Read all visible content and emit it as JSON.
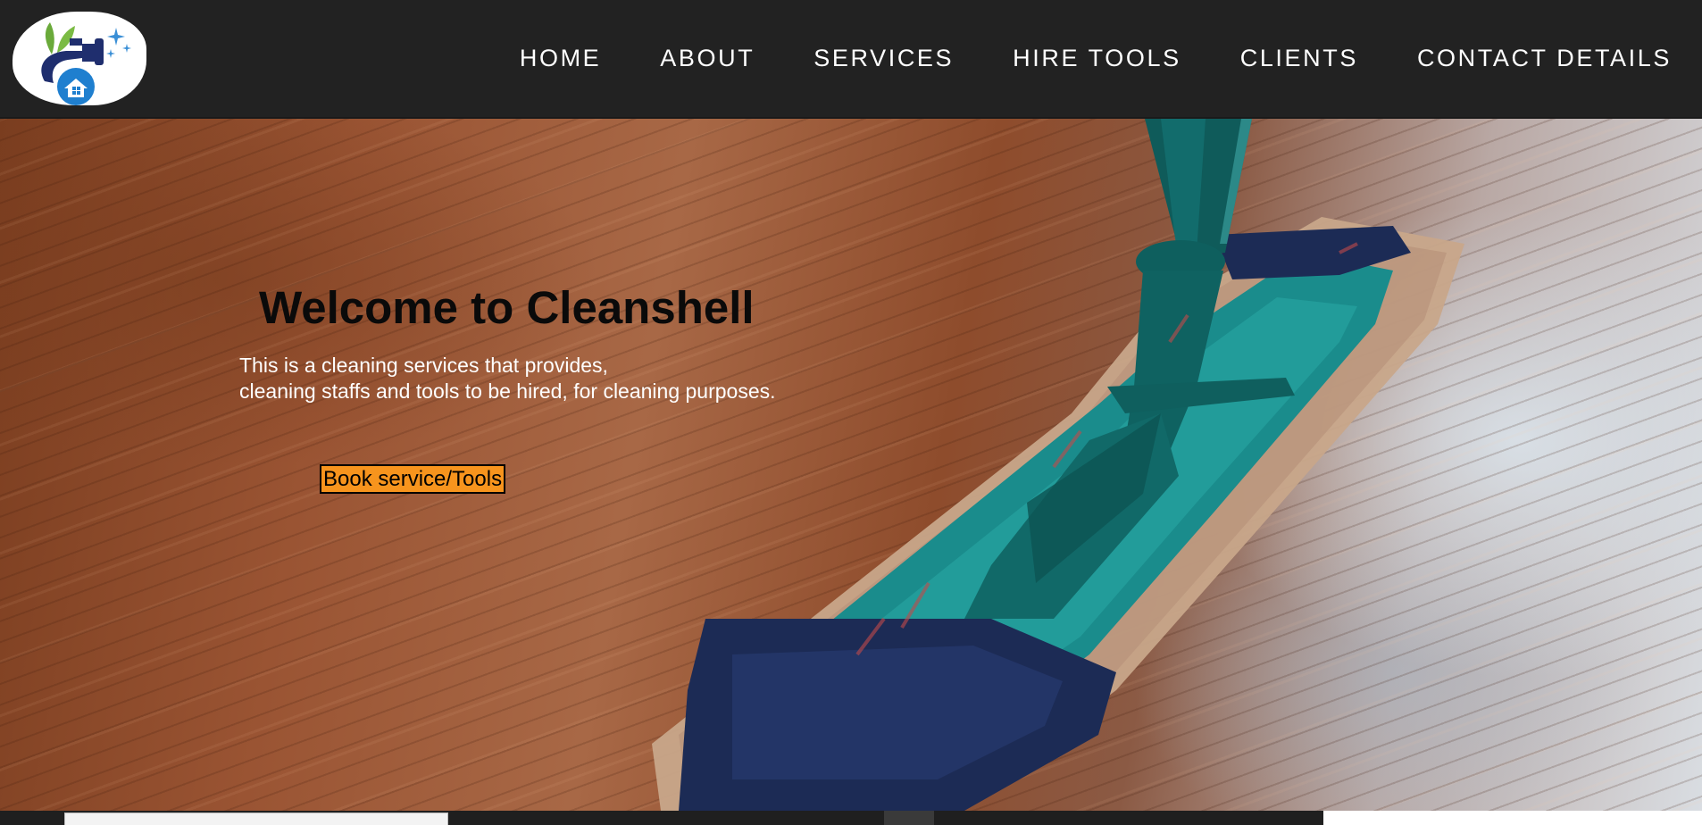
{
  "brand": {
    "logo_icon": "cleaning-house-logo"
  },
  "nav": {
    "items": [
      {
        "label": "HOME"
      },
      {
        "label": "ABOUT"
      },
      {
        "label": "SERVICES"
      },
      {
        "label": "HIRE TOOLS"
      },
      {
        "label": "CLIENTS"
      },
      {
        "label": "CONTACT DETAILS"
      }
    ]
  },
  "hero": {
    "title": "Welcome to Cleanshell",
    "description_line1": "This is a cleaning services that provides,",
    "description_line2": "cleaning staffs and tools to be hired, for cleaning purposes.",
    "cta_label": "Book service/Tools",
    "background_image": "mop-on-wooden-floor"
  },
  "colors": {
    "navbar_bg": "#222222",
    "nav_text": "#ffffff",
    "cta_bg": "#f7941d",
    "title_text": "#0a0a0a",
    "description_text": "#ffffff"
  }
}
